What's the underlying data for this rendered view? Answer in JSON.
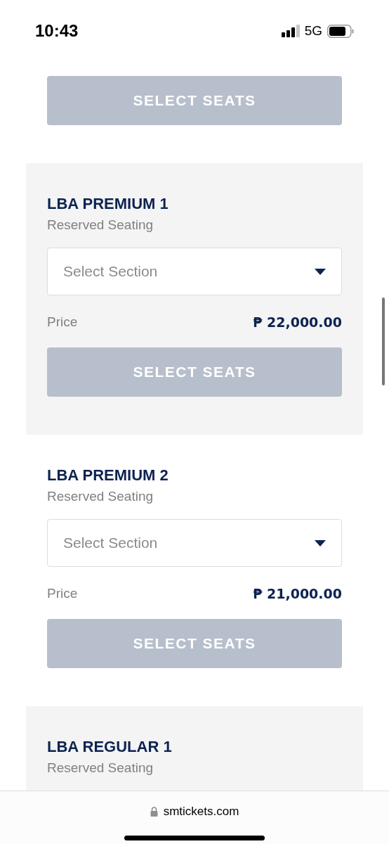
{
  "status_bar": {
    "time": "10:43",
    "network": "5G"
  },
  "sections": [
    {
      "button": {
        "label": "SELECT SEATS",
        "disabled": true
      }
    },
    {
      "title": "LBA PREMIUM 1",
      "subtitle": "Reserved Seating",
      "select": {
        "placeholder": "Select Section"
      },
      "price_label": "Price",
      "price": "₱ 22,000.00",
      "button": {
        "label": "SELECT SEATS",
        "disabled": true
      }
    },
    {
      "title": "LBA PREMIUM 2",
      "subtitle": "Reserved Seating",
      "select": {
        "placeholder": "Select Section"
      },
      "price_label": "Price",
      "price": "₱ 21,000.00",
      "button": {
        "label": "SELECT SEATS",
        "disabled": true
      }
    },
    {
      "title": "LBA REGULAR 1",
      "subtitle": "Reserved Seating"
    }
  ],
  "address_bar": {
    "url": "smtickets.com"
  }
}
